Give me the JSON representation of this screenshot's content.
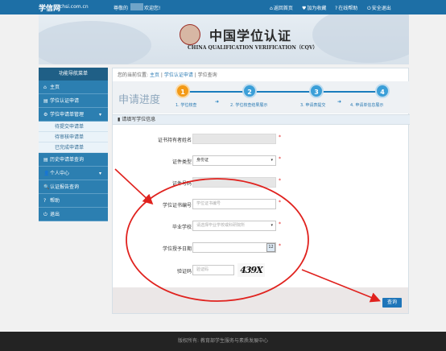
{
  "topbar": {
    "logo": "学信网",
    "domain": "chsi.com.cn",
    "greeting": "尊敬的",
    "welcome": "欢迎您!",
    "links": [
      {
        "icon": "home-icon",
        "glyph": "⌂",
        "label": "返回首页"
      },
      {
        "icon": "heart-icon",
        "glyph": "♥",
        "label": "加为收藏"
      },
      {
        "icon": "help-icon",
        "glyph": "?",
        "label": "在线帮助"
      },
      {
        "icon": "power-icon",
        "glyph": "⏻",
        "label": "安全退出"
      }
    ]
  },
  "banner": {
    "title_cn": "中国学位认证",
    "title_en": "CHINA QUALIFICATION VERIFICATION（CQV）"
  },
  "sidebar": {
    "header": "功能导航菜单",
    "items": [
      {
        "label": "主页",
        "glyph": "⌂"
      },
      {
        "label": "学位认证申请",
        "glyph": "▤"
      },
      {
        "label": "学位申请单管理",
        "glyph": "⚙",
        "chevron": "▾"
      },
      {
        "label": "待提交申请单",
        "sub": true
      },
      {
        "label": "待审核申请单",
        "sub": true
      },
      {
        "label": "已完成申请单",
        "sub": true
      },
      {
        "label": "历史申请单查询",
        "glyph": "▤"
      },
      {
        "label": "个人中心",
        "glyph": "👤",
        "chevron": "▾"
      },
      {
        "label": "认证报告查询",
        "glyph": "🔍"
      },
      {
        "label": "帮助",
        "glyph": "?"
      },
      {
        "label": "退出",
        "glyph": "⏻"
      }
    ]
  },
  "breadcrumb": {
    "prefix": "您的当前位置:",
    "items": [
      "主页",
      "学位认证申请",
      "学位查询"
    ]
  },
  "progress": {
    "title": "申请进度",
    "steps": [
      {
        "num": "1",
        "label": "1. 学位核查"
      },
      {
        "num": "2",
        "label": "2. 学位核查结果展示"
      },
      {
        "num": "3",
        "label": "3. 申请表提交"
      },
      {
        "num": "4",
        "label": "4. 申请单信息展示"
      }
    ],
    "active_step": 1
  },
  "form": {
    "section_title": "请填写学位信息",
    "holder_name_label": "证书持有者姓名",
    "id_type_label": "证件类型",
    "id_type_value": "身份证",
    "id_number_label": "证件号码",
    "cert_number_label": "学位证书编号",
    "cert_number_placeholder": "学位证书编号",
    "school_label": "毕业学校",
    "school_placeholder": "请选择毕业学校或科研院所",
    "date_label": "学位授予日期",
    "date_button": "12",
    "captcha_label": "验证码",
    "captcha_placeholder": "验证码",
    "captcha_text": "439X",
    "required_mark": "*",
    "query_button": "查询"
  },
  "footer": {
    "text": "版权所有: 教育部学生服务与素质发展中心"
  },
  "annotation": {
    "color": "#e0221e"
  }
}
